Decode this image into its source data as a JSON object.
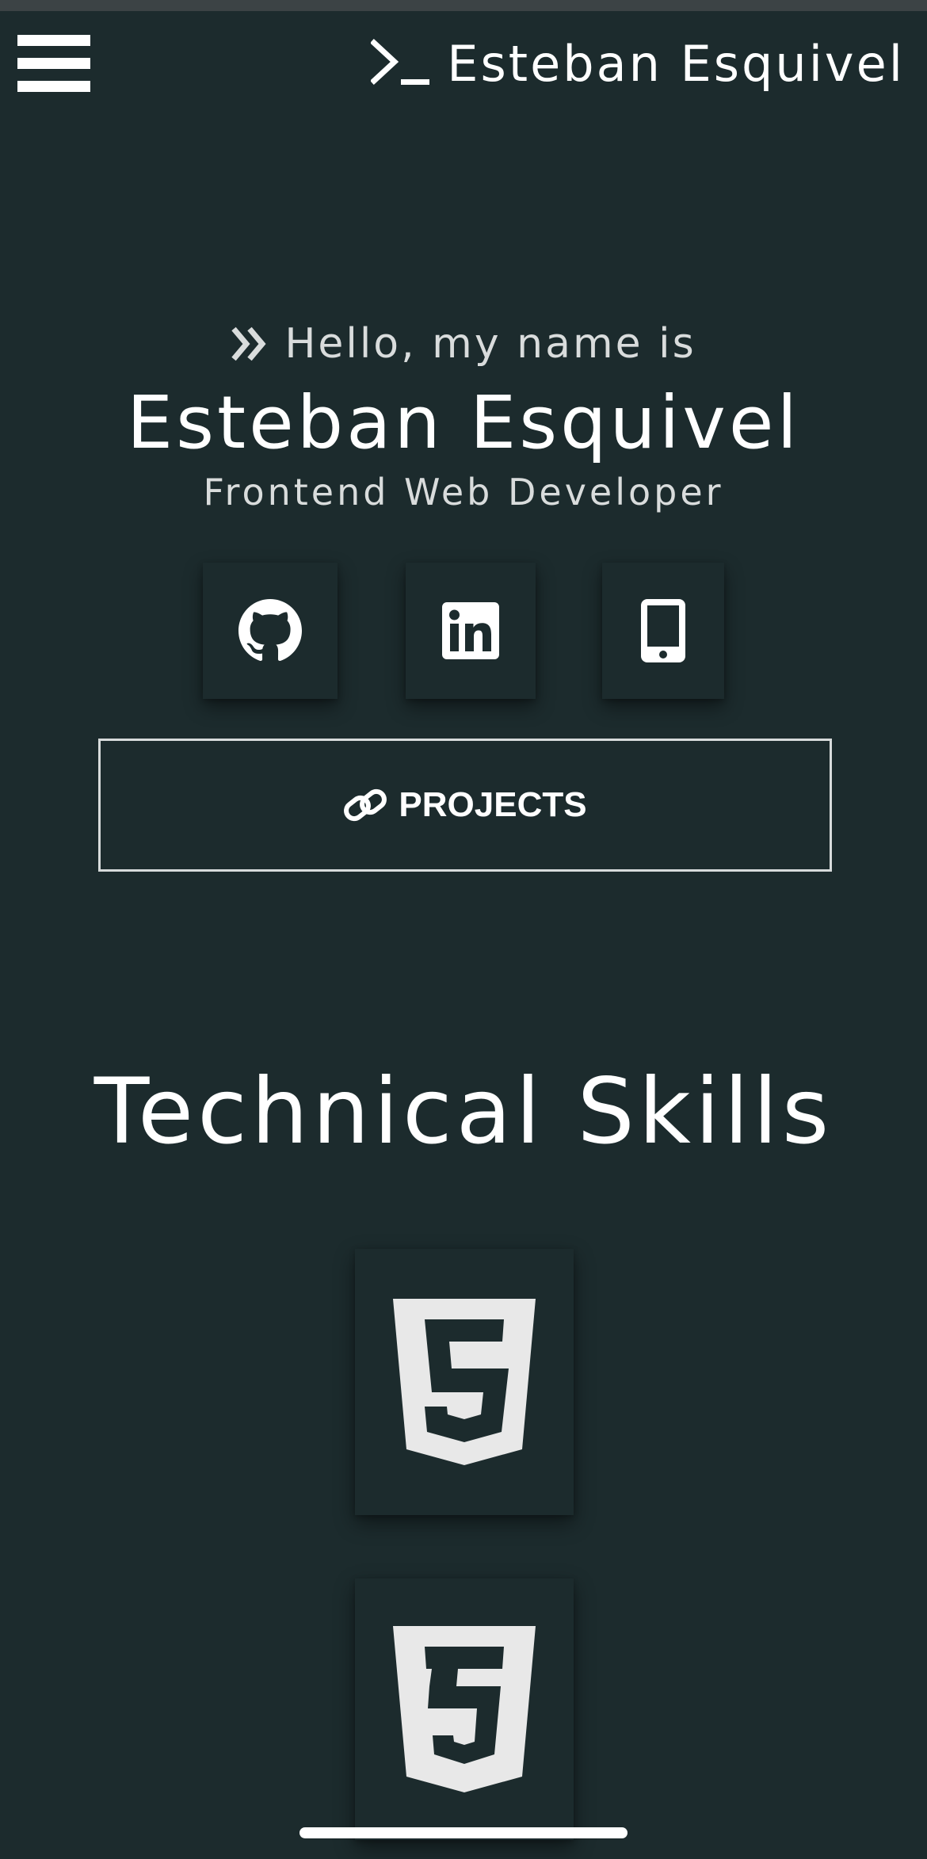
{
  "header": {
    "menu_icon": "hamburger-menu-icon",
    "brand_icon": "terminal-prompt-icon",
    "brand_name": "Esteban Esquivel"
  },
  "hero": {
    "greeting_icon": "double-chevron-right-icon",
    "greeting": "Hello, my name is",
    "name": "Esteban Esquivel",
    "role": "Frontend Web Developer"
  },
  "social_links": [
    {
      "icon": "github-icon"
    },
    {
      "icon": "linkedin-icon"
    },
    {
      "icon": "mobile-phone-icon"
    }
  ],
  "projects_button": {
    "icon": "link-icon",
    "label": "PROJECTS"
  },
  "skills": {
    "title": "Technical Skills",
    "items": [
      {
        "icon": "html5-icon"
      },
      {
        "icon": "css3-icon"
      }
    ]
  },
  "colors": {
    "background": "#1c2b2d",
    "text": "#ffffff",
    "muted_text": "#d9dcdc",
    "icon_fill": "#e8e8e8",
    "status_strip": "#3c4345"
  }
}
